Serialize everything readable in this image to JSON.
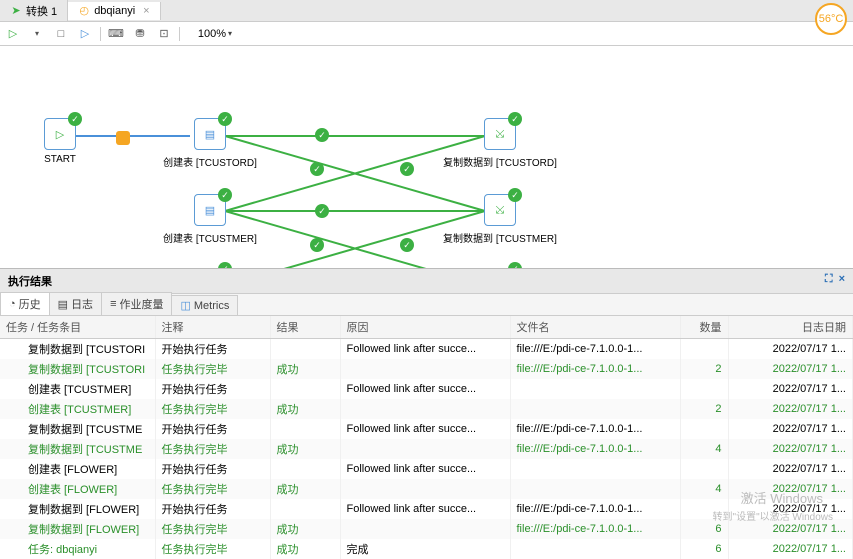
{
  "tabs": {
    "t0": "转换 1",
    "t1": "dbqianyi"
  },
  "zoom": "100%",
  "temp": "56°C",
  "nodes": {
    "start": "START",
    "ct_tcord": "创建表 [TCUSTORD]",
    "cp_tcord": "复制数据到 [TCUSTORD]",
    "ct_tcmer": "创建表 [TCUSTMER]",
    "cp_tcmer": "复制数据到 [TCUSTMER]"
  },
  "results_title": "执行结果",
  "subtabs": {
    "history": "历史",
    "log": "日志",
    "jobs": "作业度量",
    "metrics": "Metrics"
  },
  "cols": {
    "task": "任务 / 任务条目",
    "note": "注释",
    "result": "结果",
    "reason": "原因",
    "file": "文件名",
    "qty": "数量",
    "date": "日志日期"
  },
  "rows": [
    {
      "task": "复制数据到 [TCUSTORI",
      "note": "开始执行任务",
      "result": "",
      "reason": "Followed link after succe...",
      "file": "file:///E:/pdi-ce-7.1.0.0-1...",
      "qty": "",
      "date": "2022/07/17 1...",
      "g": false
    },
    {
      "task": "复制数据到 [TCUSTORI",
      "note": "任务执行完毕",
      "result": "成功",
      "reason": "",
      "file": "file:///E:/pdi-ce-7.1.0.0-1...",
      "qty": "2",
      "date": "2022/07/17 1...",
      "g": true
    },
    {
      "task": "创建表 [TCUSTMER]",
      "note": "开始执行任务",
      "result": "",
      "reason": "Followed link after succe...",
      "file": "",
      "qty": "",
      "date": "2022/07/17 1...",
      "g": false
    },
    {
      "task": "创建表 [TCUSTMER]",
      "note": "任务执行完毕",
      "result": "成功",
      "reason": "",
      "file": "",
      "qty": "2",
      "date": "2022/07/17 1...",
      "g": true
    },
    {
      "task": "复制数据到 [TCUSTME",
      "note": "开始执行任务",
      "result": "",
      "reason": "Followed link after succe...",
      "file": "file:///E:/pdi-ce-7.1.0.0-1...",
      "qty": "",
      "date": "2022/07/17 1...",
      "g": false
    },
    {
      "task": "复制数据到 [TCUSTME",
      "note": "任务执行完毕",
      "result": "成功",
      "reason": "",
      "file": "file:///E:/pdi-ce-7.1.0.0-1...",
      "qty": "4",
      "date": "2022/07/17 1...",
      "g": true
    },
    {
      "task": "创建表 [FLOWER]",
      "note": "开始执行任务",
      "result": "",
      "reason": "Followed link after succe...",
      "file": "",
      "qty": "",
      "date": "2022/07/17 1...",
      "g": false
    },
    {
      "task": "创建表 [FLOWER]",
      "note": "任务执行完毕",
      "result": "成功",
      "reason": "",
      "file": "",
      "qty": "4",
      "date": "2022/07/17 1...",
      "g": true
    },
    {
      "task": "复制数据到 [FLOWER]",
      "note": "开始执行任务",
      "result": "",
      "reason": "Followed link after succe...",
      "file": "file:///E:/pdi-ce-7.1.0.0-1...",
      "qty": "",
      "date": "2022/07/17 1...",
      "g": false
    },
    {
      "task": "复制数据到 [FLOWER]",
      "note": "任务执行完毕",
      "result": "成功",
      "reason": "",
      "file": "file:///E:/pdi-ce-7.1.0.0-1...",
      "qty": "6",
      "date": "2022/07/17 1...",
      "g": true
    },
    {
      "task": "任务: dbqianyi",
      "note": "任务执行完毕",
      "result": "成功",
      "reason": "完成",
      "file": "",
      "qty": "6",
      "date": "2022/07/17 1...",
      "g": true
    }
  ],
  "wm1": "激活 Windows",
  "wm2": "转到\"设置\"以激活 Windows"
}
